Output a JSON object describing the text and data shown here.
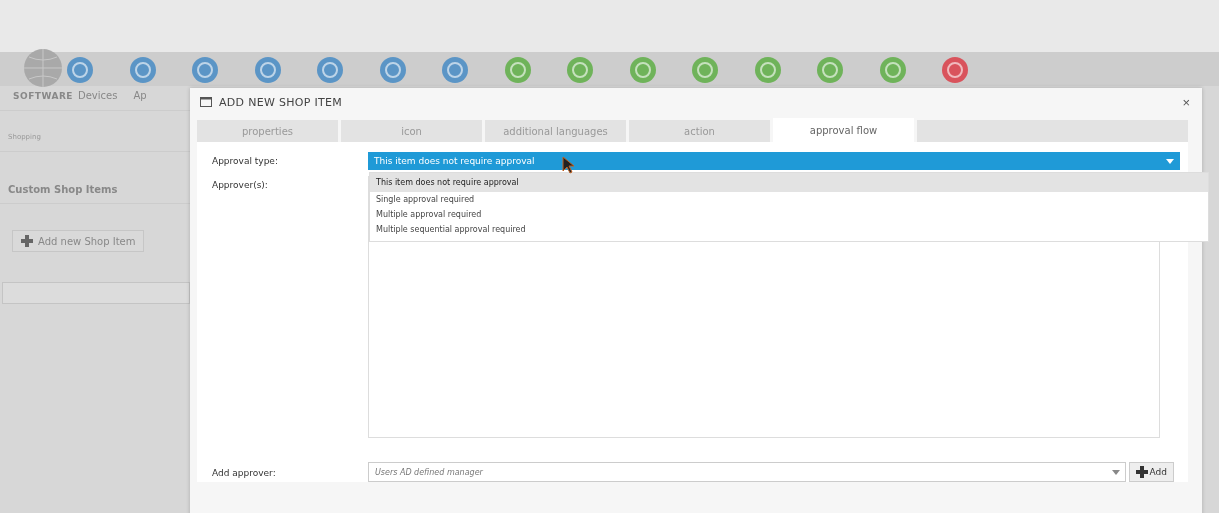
{
  "header": {
    "logo": "SOFTWARE",
    "nav": [
      "Devices",
      "Ap"
    ],
    "toolbar_icons": [
      {
        "color": "#5b95c6"
      },
      {
        "color": "#5b95c6"
      },
      {
        "color": "#5b95c6"
      },
      {
        "color": "#5b95c6"
      },
      {
        "color": "#5b95c6"
      },
      {
        "color": "#5b95c6"
      },
      {
        "color": "#5b95c6"
      },
      {
        "color": "#6fb35a"
      },
      {
        "color": "#6fb35a"
      },
      {
        "color": "#6fb35a"
      },
      {
        "color": "#6fb35a"
      },
      {
        "color": "#6fb35a"
      },
      {
        "color": "#6fb35a"
      },
      {
        "color": "#6fb35a"
      },
      {
        "color": "#d9535c"
      }
    ]
  },
  "sidebar": {
    "breadcrumb": "Shopping",
    "heading": "Custom Shop Items",
    "add_button": "Add new Shop Item"
  },
  "dialog": {
    "title": "ADD NEW SHOP ITEM",
    "close": "×",
    "tabs": [
      {
        "label": "properties",
        "selected": false
      },
      {
        "label": "icon",
        "selected": false
      },
      {
        "label": "additional languages",
        "selected": false
      },
      {
        "label": "action",
        "selected": false
      },
      {
        "label": "approval flow",
        "selected": true
      }
    ],
    "approval_type": {
      "label": "Approval type:",
      "value": "This item does not require approval",
      "options": [
        {
          "label": "This item does not require approval",
          "selected": true
        },
        {
          "label": "Single approval required",
          "selected": false
        },
        {
          "label": "Multiple approval required",
          "selected": false
        },
        {
          "label": "Multiple sequential approval required",
          "selected": false
        }
      ]
    },
    "approvers": {
      "label": "Approver(s):"
    },
    "add_approver": {
      "label": "Add approver:",
      "value": "Users AD defined manager",
      "button": "Add"
    }
  }
}
